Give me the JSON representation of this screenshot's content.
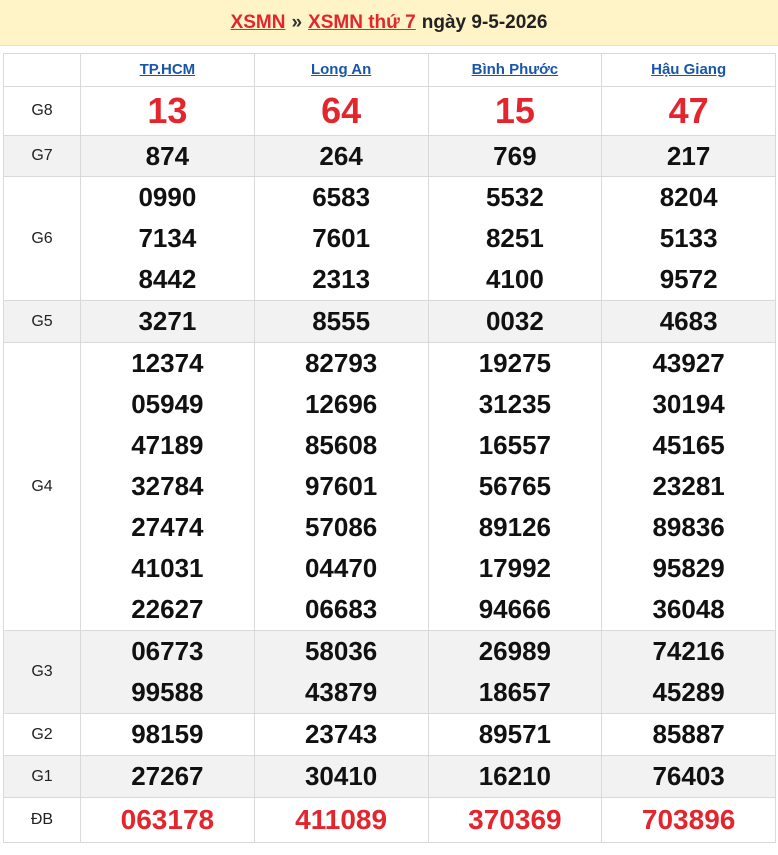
{
  "header": {
    "link1": "XSMN",
    "separator": "»",
    "link2": "XSMN thứ 7",
    "date": "ngày 9-5-2026"
  },
  "provinces": [
    "TP.HCM",
    "Long An",
    "Bình Phước",
    "Hậu Giang"
  ],
  "prizes": [
    {
      "label": "G8",
      "values": [
        [
          "13"
        ],
        [
          "64"
        ],
        [
          "15"
        ],
        [
          "47"
        ]
      ]
    },
    {
      "label": "G7",
      "values": [
        [
          "874"
        ],
        [
          "264"
        ],
        [
          "769"
        ],
        [
          "217"
        ]
      ]
    },
    {
      "label": "G6",
      "values": [
        [
          "0990",
          "7134",
          "8442"
        ],
        [
          "6583",
          "7601",
          "2313"
        ],
        [
          "5532",
          "8251",
          "4100"
        ],
        [
          "8204",
          "5133",
          "9572"
        ]
      ]
    },
    {
      "label": "G5",
      "values": [
        [
          "3271"
        ],
        [
          "8555"
        ],
        [
          "0032"
        ],
        [
          "4683"
        ]
      ]
    },
    {
      "label": "G4",
      "values": [
        [
          "12374",
          "05949",
          "47189",
          "32784",
          "27474",
          "41031",
          "22627"
        ],
        [
          "82793",
          "12696",
          "85608",
          "97601",
          "57086",
          "04470",
          "06683"
        ],
        [
          "19275",
          "31235",
          "16557",
          "56765",
          "89126",
          "17992",
          "94666"
        ],
        [
          "43927",
          "30194",
          "45165",
          "23281",
          "89836",
          "95829",
          "36048"
        ]
      ]
    },
    {
      "label": "G3",
      "values": [
        [
          "06773",
          "99588"
        ],
        [
          "58036",
          "43879"
        ],
        [
          "26989",
          "18657"
        ],
        [
          "74216",
          "45289"
        ]
      ]
    },
    {
      "label": "G2",
      "values": [
        [
          "98159"
        ],
        [
          "23743"
        ],
        [
          "89571"
        ],
        [
          "85887"
        ]
      ]
    },
    {
      "label": "G1",
      "values": [
        [
          "27267"
        ],
        [
          "30410"
        ],
        [
          "16210"
        ],
        [
          "76403"
        ]
      ]
    },
    {
      "label": "ĐB",
      "values": [
        [
          "063178"
        ],
        [
          "411089"
        ],
        [
          "370369"
        ],
        [
          "703896"
        ]
      ]
    }
  ],
  "colors": {
    "accent": "#e3262e",
    "link": "#1a56a8",
    "header_bg": "#fff4c8",
    "alt_row": "#f2f2f2"
  }
}
